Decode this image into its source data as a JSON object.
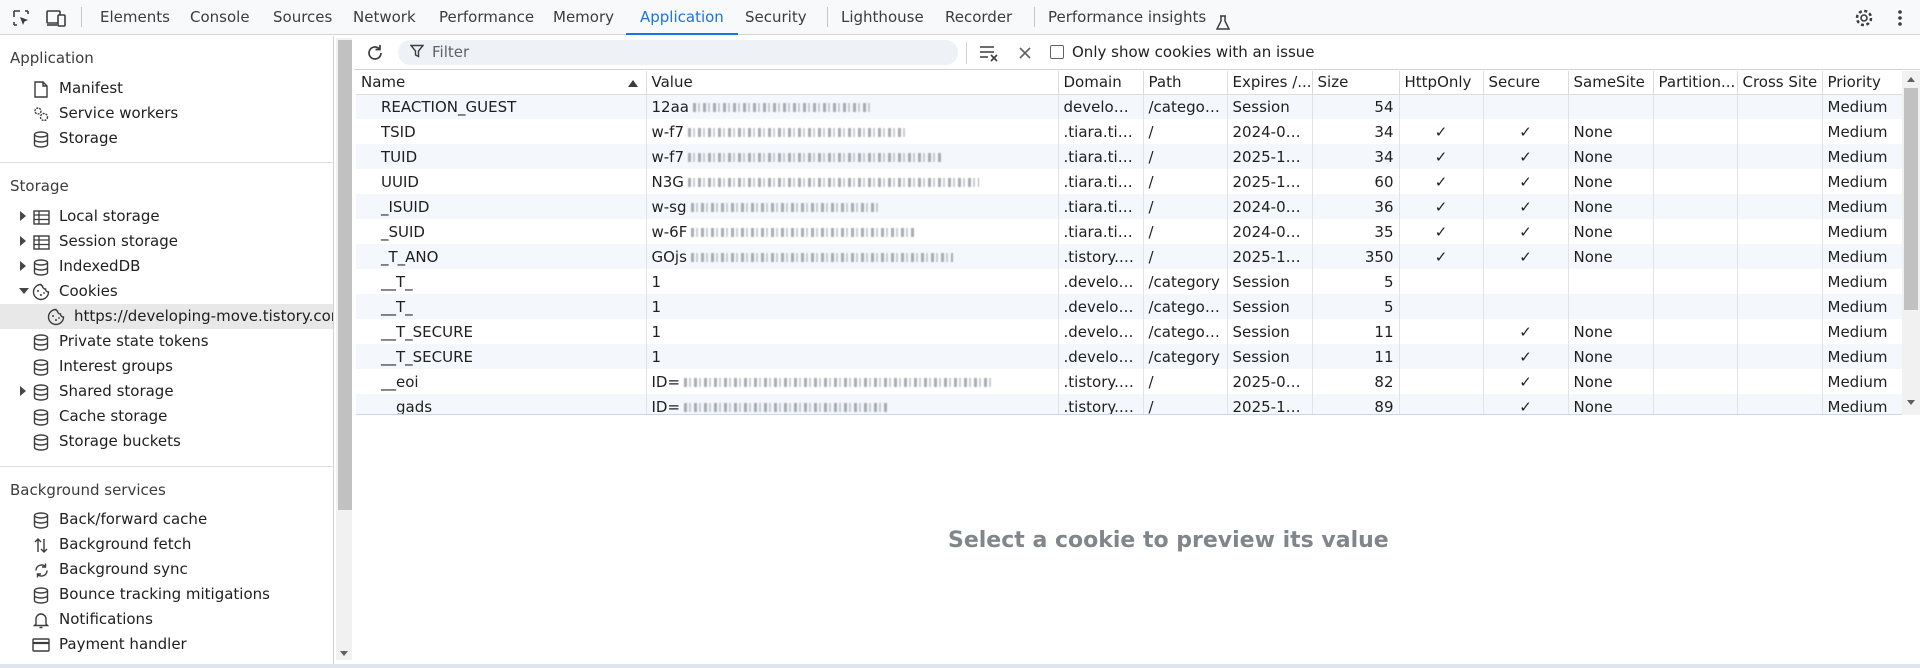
{
  "tabs": [
    {
      "label": "Elements",
      "active": false
    },
    {
      "label": "Console",
      "active": false
    },
    {
      "label": "Sources",
      "active": false
    },
    {
      "label": "Network",
      "active": false
    },
    {
      "label": "Performance",
      "active": false
    },
    {
      "label": "Memory",
      "active": false
    },
    {
      "label": "Application",
      "active": true
    },
    {
      "label": "Security",
      "active": false
    },
    {
      "label": "Lighthouse",
      "active": false
    },
    {
      "label": "Recorder",
      "active": false
    },
    {
      "label": "Performance insights",
      "active": false
    }
  ],
  "icons": {
    "inspect": "select-element-icon",
    "device": "device-toolbar-icon",
    "flask": "experiment-flask-icon",
    "settings": "gear-icon",
    "more": "kebab-menu-icon"
  },
  "colors": {
    "accent": "#1a73e8",
    "row_alt": "#f4f7fc",
    "selected": "#e8e8e8",
    "muted_text": "#80868b"
  },
  "sidebar": {
    "application": {
      "header": "Application",
      "items": [
        {
          "label": "Manifest",
          "icon": "document-icon"
        },
        {
          "label": "Service workers",
          "icon": "gears-icon"
        },
        {
          "label": "Storage",
          "icon": "database-icon"
        }
      ]
    },
    "storage": {
      "header": "Storage",
      "items": [
        {
          "label": "Local storage",
          "icon": "table-icon",
          "expandable": "collapsed"
        },
        {
          "label": "Session storage",
          "icon": "table-icon",
          "expandable": "collapsed"
        },
        {
          "label": "IndexedDB",
          "icon": "database-icon",
          "expandable": "collapsed"
        },
        {
          "label": "Cookies",
          "icon": "cookie-icon",
          "expandable": "expanded"
        },
        {
          "label": "https://developing-move.tistory.com",
          "icon": "cookie-icon",
          "selected": true
        },
        {
          "label": "Private state tokens",
          "icon": "database-icon"
        },
        {
          "label": "Interest groups",
          "icon": "database-icon"
        },
        {
          "label": "Shared storage",
          "icon": "database-icon",
          "expandable": "collapsed"
        },
        {
          "label": "Cache storage",
          "icon": "database-icon"
        },
        {
          "label": "Storage buckets",
          "icon": "database-icon"
        }
      ]
    },
    "background": {
      "header": "Background services",
      "items": [
        {
          "label": "Back/forward cache",
          "icon": "database-icon"
        },
        {
          "label": "Background fetch",
          "icon": "updown-arrows-icon"
        },
        {
          "label": "Background sync",
          "icon": "sync-icon"
        },
        {
          "label": "Bounce tracking mitigations",
          "icon": "database-icon"
        },
        {
          "label": "Notifications",
          "icon": "bell-icon"
        },
        {
          "label": "Payment handler",
          "icon": "card-icon"
        }
      ]
    }
  },
  "filter": {
    "placeholder": "Filter",
    "only_issue_label": "Only show cookies with an issue",
    "only_issue_checked": false
  },
  "table": {
    "columns": [
      "Name",
      "Value",
      "Domain",
      "Path",
      "Expires /...",
      "Size",
      "HttpOnly",
      "Secure",
      "SameSite",
      "Partition...",
      "Cross Site",
      "Priority"
    ],
    "sorted_column": "Name",
    "sort_direction": "ascending",
    "rows": [
      {
        "name": "REACTION_GUEST",
        "value": "12aa",
        "domain": "developi...",
        "path": "/categor...",
        "expires": "Session",
        "size": "54",
        "httponly": "",
        "secure": "",
        "samesite": "",
        "partition": "",
        "crosssite": "",
        "priority": "Medium"
      },
      {
        "name": "TSID",
        "value": "w-f7",
        "domain": ".tiara.tist...",
        "path": "/",
        "expires": "2024-09-...",
        "size": "34",
        "httponly": "✓",
        "secure": "✓",
        "samesite": "None",
        "partition": "",
        "crosssite": "",
        "priority": "Medium"
      },
      {
        "name": "TUID",
        "value": "w-f7",
        "domain": ".tiara.tist...",
        "path": "/",
        "expires": "2025-10-...",
        "size": "34",
        "httponly": "✓",
        "secure": "✓",
        "samesite": "None",
        "partition": "",
        "crosssite": "",
        "priority": "Medium"
      },
      {
        "name": "UUID",
        "value": "N3G",
        "domain": ".tiara.tist...",
        "path": "/",
        "expires": "2025-10-...",
        "size": "60",
        "httponly": "✓",
        "secure": "✓",
        "samesite": "None",
        "partition": "",
        "crosssite": "",
        "priority": "Medium"
      },
      {
        "name": "_ISUID",
        "value": "w-sg",
        "domain": ".tiara.tist...",
        "path": "/",
        "expires": "2024-09-...",
        "size": "36",
        "httponly": "✓",
        "secure": "✓",
        "samesite": "None",
        "partition": "",
        "crosssite": "",
        "priority": "Medium"
      },
      {
        "name": "_SUID",
        "value": "w-6F",
        "domain": ".tiara.tist...",
        "path": "/",
        "expires": "2024-09-...",
        "size": "35",
        "httponly": "✓",
        "secure": "✓",
        "samesite": "None",
        "partition": "",
        "crosssite": "",
        "priority": "Medium"
      },
      {
        "name": "_T_ANO",
        "value": "GOjs",
        "domain": ".tistory.c...",
        "path": "/",
        "expires": "2025-10-...",
        "size": "350",
        "httponly": "✓",
        "secure": "✓",
        "samesite": "None",
        "partition": "",
        "crosssite": "",
        "priority": "Medium"
      },
      {
        "name": "__T_",
        "value": "1",
        "domain": ".developi...",
        "path": "/category",
        "expires": "Session",
        "size": "5",
        "httponly": "",
        "secure": "",
        "samesite": "",
        "partition": "",
        "crosssite": "",
        "priority": "Medium"
      },
      {
        "name": "__T_",
        "value": "1",
        "domain": ".developi...",
        "path": "/categor...",
        "expires": "Session",
        "size": "5",
        "httponly": "",
        "secure": "",
        "samesite": "",
        "partition": "",
        "crosssite": "",
        "priority": "Medium"
      },
      {
        "name": "__T_SECURE",
        "value": "1",
        "domain": ".developi...",
        "path": "/categor...",
        "expires": "Session",
        "size": "11",
        "httponly": "",
        "secure": "✓",
        "samesite": "None",
        "partition": "",
        "crosssite": "",
        "priority": "Medium"
      },
      {
        "name": "__T_SECURE",
        "value": "1",
        "domain": ".developi...",
        "path": "/category",
        "expires": "Session",
        "size": "11",
        "httponly": "",
        "secure": "✓",
        "samesite": "None",
        "partition": "",
        "crosssite": "",
        "priority": "Medium"
      },
      {
        "name": "__eoi",
        "value": "ID=",
        "domain": ".tistory.c...",
        "path": "/",
        "expires": "2025-03-...",
        "size": "82",
        "httponly": "",
        "secure": "✓",
        "samesite": "None",
        "partition": "",
        "crosssite": "",
        "priority": "Medium"
      },
      {
        "name": "__gads",
        "value": "ID=",
        "domain": ".tistory.c...",
        "path": "/",
        "expires": "2025-10-...",
        "size": "89",
        "httponly": "",
        "secure": "✓",
        "samesite": "None",
        "partition": "",
        "crosssite": "",
        "priority": "Medium"
      }
    ]
  },
  "preview": {
    "empty_message": "Select a cookie to preview its value"
  }
}
